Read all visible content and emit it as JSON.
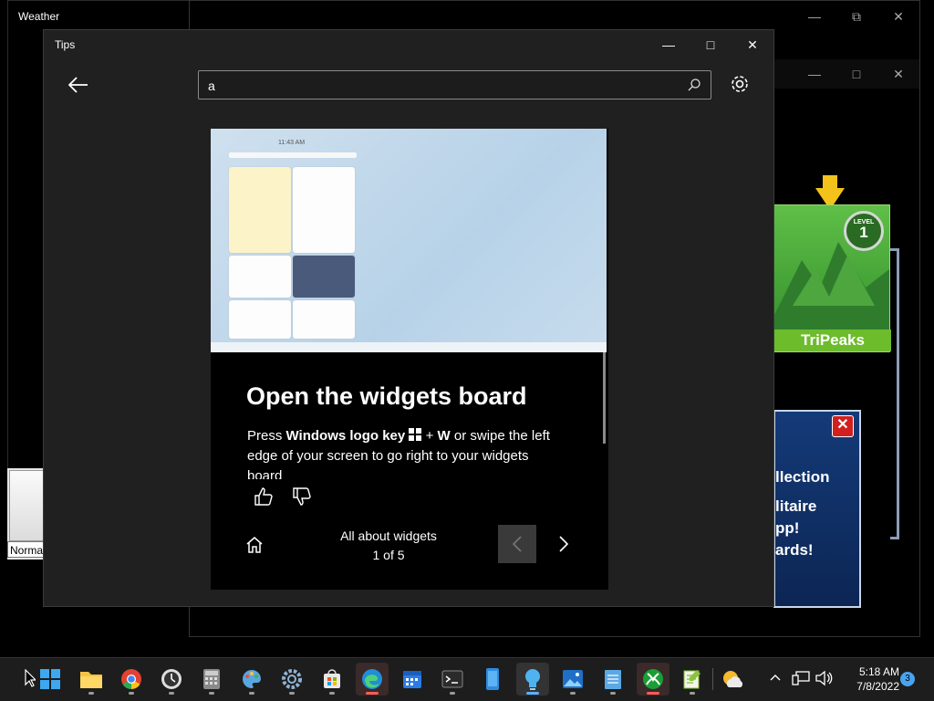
{
  "weather_window": {
    "title": "Weather"
  },
  "background_label": {
    "text": "Norma"
  },
  "solitaire": {
    "tile_name": "TriPeaks",
    "level_label": "LEVEL",
    "level_number": "1",
    "popup_line1": "llection",
    "popup_line2": "litaire",
    "popup_line3": "pp!",
    "popup_line4": "ards!"
  },
  "tips": {
    "window_title": "Tips",
    "search": {
      "value": "a"
    },
    "preview_time": "11:43 AM",
    "card": {
      "title": "Open the widgets board",
      "body_prefix": "Press ",
      "body_key": "Windows logo key",
      "body_plus": " + ",
      "body_w": "W",
      "body_rest": " or swipe the left edge of your screen to go right to your widgets board"
    },
    "collection_title": "All about widgets",
    "page_indicator": "1 of 5"
  },
  "taskbar": {
    "time": "5:18 AM",
    "date": "7/8/2022",
    "notification_count": "3",
    "apps": [
      {
        "name": "start-icon"
      },
      {
        "name": "file-explorer-icon"
      },
      {
        "name": "chrome-icon"
      },
      {
        "name": "clock-icon"
      },
      {
        "name": "calculator-icon"
      },
      {
        "name": "paint-icon"
      },
      {
        "name": "settings-icon"
      },
      {
        "name": "store-icon"
      },
      {
        "name": "edge-icon"
      },
      {
        "name": "calendar-icon"
      },
      {
        "name": "terminal-icon"
      },
      {
        "name": "phone-icon"
      },
      {
        "name": "tips-icon"
      },
      {
        "name": "photos-icon"
      },
      {
        "name": "notepad-icon"
      },
      {
        "name": "xbox-icon"
      },
      {
        "name": "notepadpp-icon"
      },
      {
        "name": "weather-icon"
      }
    ]
  },
  "colors": {
    "accent": "#5ab0ff",
    "tripeaks_green": "#6cbc2c",
    "popup_blue": "#143a78"
  }
}
